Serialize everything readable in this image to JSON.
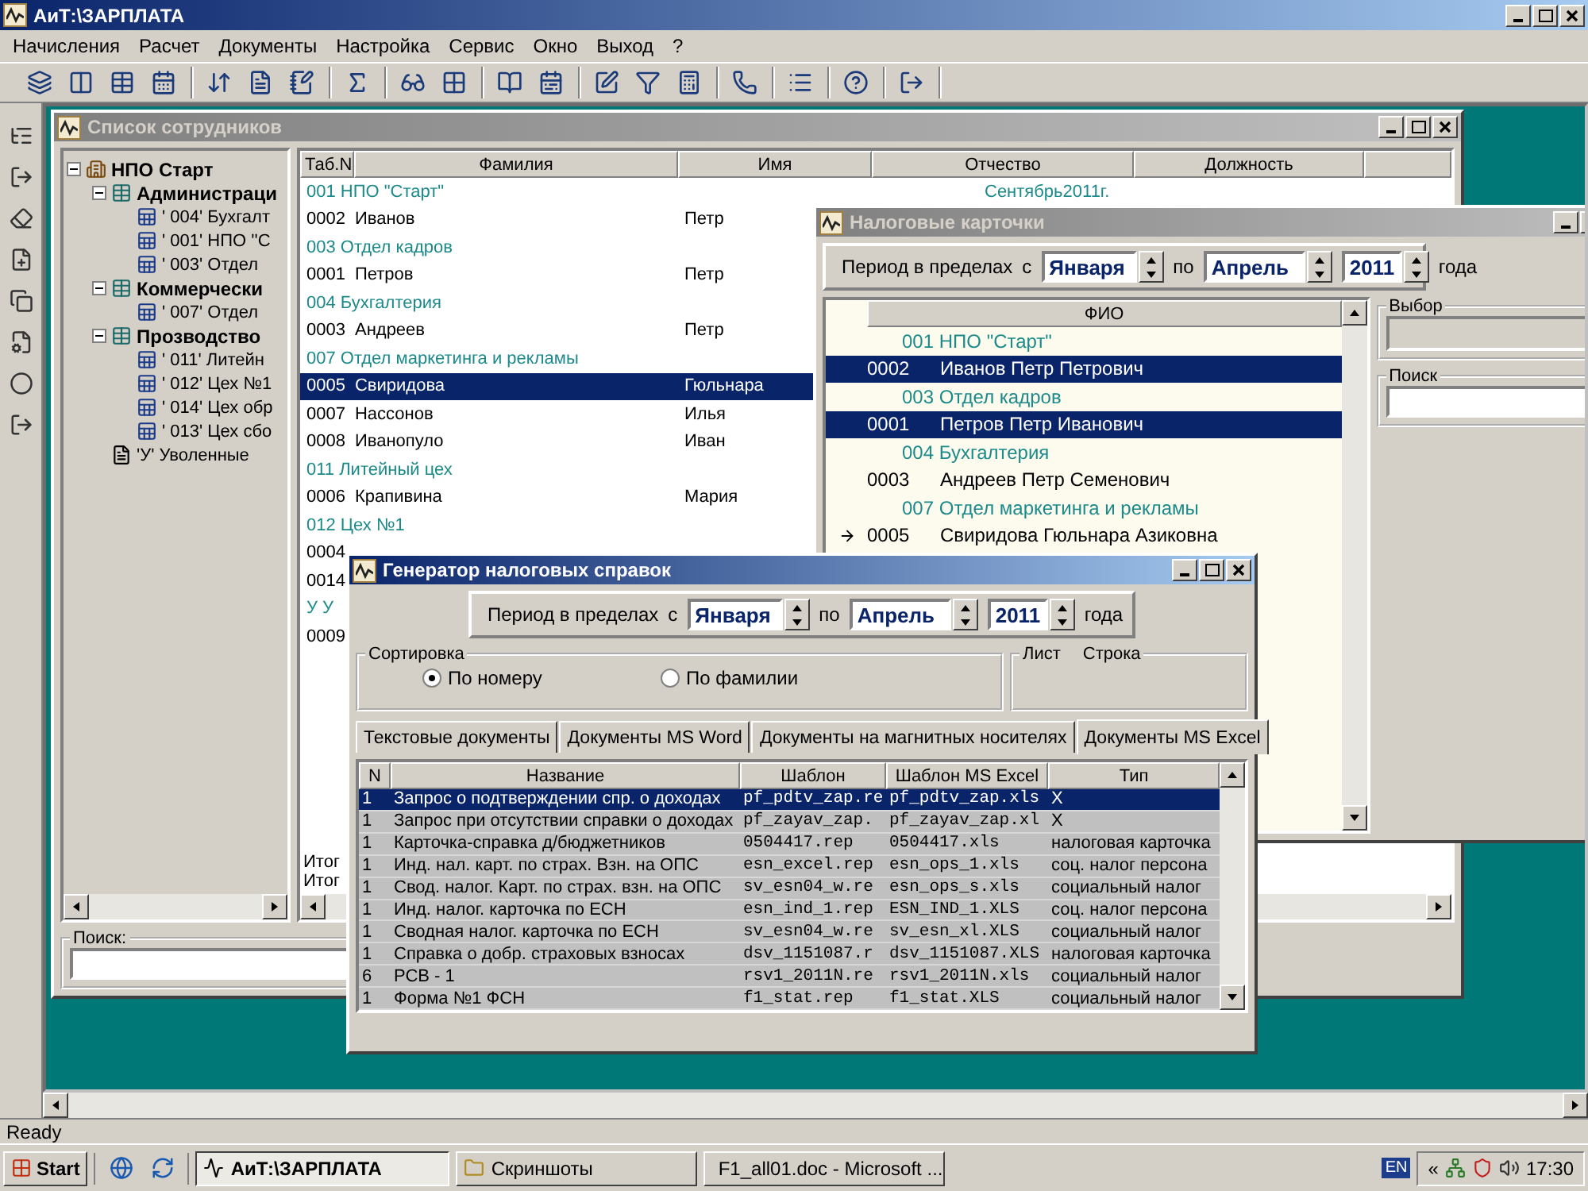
{
  "app": {
    "title": "АиТ:\\ЗАРПЛАТА",
    "active": true
  },
  "menu": [
    "Начисления",
    "Расчет",
    "Документы",
    "Настройка",
    "Сервис",
    "Окно",
    "Выход",
    "?"
  ],
  "employees_window": {
    "title": "Список сотрудников",
    "active": false,
    "tree": [
      {
        "label": "НПО Старт",
        "kind": "company",
        "expanded": true,
        "children": [
          {
            "label": "Администраци",
            "kind": "division",
            "expanded": true,
            "children": [
              {
                "label": "' 004' Бухгалт",
                "kind": "department"
              },
              {
                "label": "' 001' НПО ''С",
                "kind": "department"
              },
              {
                "label": "' 003' Отдел",
                "kind": "department"
              }
            ]
          },
          {
            "label": "Коммерчески",
            "kind": "division",
            "expanded": true,
            "children": [
              {
                "label": "' 007' Отдел",
                "kind": "department"
              }
            ]
          },
          {
            "label": "Прозводство",
            "kind": "division",
            "expanded": true,
            "children": [
              {
                "label": "' 011' Литейн",
                "kind": "department"
              },
              {
                "label": "' 012' Цех №1",
                "kind": "department"
              },
              {
                "label": "' 014' Цех обр",
                "kind": "department"
              },
              {
                "label": "' 013' Цех сбо",
                "kind": "department"
              }
            ]
          },
          {
            "label": "'У' Уволенные",
            "kind": "dismissed"
          }
        ]
      }
    ],
    "columns": [
      "Таб.N",
      "Фамилия",
      "Имя",
      "Отчество",
      "Должность"
    ],
    "rows": [
      {
        "kind": "group",
        "text": "001 НПО \"Старт\"",
        "note": "Сентябрь2011г.",
        "selected": false
      },
      {
        "kind": "person",
        "num": "0002",
        "surname": "Иванов",
        "name": "Петр",
        "selected": false
      },
      {
        "kind": "group",
        "text": "003 Отдел кадров",
        "selected": false
      },
      {
        "kind": "person",
        "num": "0001",
        "surname": "Петров",
        "name": "Петр",
        "selected": false
      },
      {
        "kind": "group",
        "text": "004 Бухгалтерия",
        "selected": false
      },
      {
        "kind": "person",
        "num": "0003",
        "surname": "Андреев",
        "name": "Петр",
        "selected": false
      },
      {
        "kind": "group",
        "text": "007 Отдел маркетинга и рекламы",
        "selected": false
      },
      {
        "kind": "person",
        "num": "0005",
        "surname": "Свиридова",
        "name": "Гюльнара",
        "selected": true
      },
      {
        "kind": "person",
        "num": "0007",
        "surname": "Нассонов",
        "name": "Илья",
        "selected": false
      },
      {
        "kind": "person",
        "num": "0008",
        "surname": "Иванопуло",
        "name": "Иван",
        "selected": false
      },
      {
        "kind": "group",
        "text": "011 Литейный цех",
        "selected": false
      },
      {
        "kind": "person",
        "num": "0006",
        "surname": "Крапивина",
        "name": "Мария",
        "selected": false
      },
      {
        "kind": "group",
        "text": "012 Цех №1",
        "selected": false
      },
      {
        "kind": "person",
        "num": "0004",
        "selected": false
      },
      {
        "kind": "person",
        "num": "0014",
        "selected": false
      },
      {
        "kind": "group",
        "text": "У У",
        "selected": false
      },
      {
        "kind": "person",
        "num": "0009",
        "selected": false
      }
    ],
    "totals": [
      "Итог",
      "Итог"
    ],
    "search_label": "Поиск:"
  },
  "tax_window": {
    "title": "Налоговые карточки",
    "active": false,
    "period": {
      "label": "Период в пределах",
      "from_prefix": "с",
      "from": "Января",
      "to_prefix": "по",
      "to": "Апрель",
      "year": "2011",
      "suffix": "года"
    },
    "column": "ФИО",
    "rows": [
      {
        "kind": "group",
        "text": "001 НПО \"Старт\"",
        "selected": false,
        "current": false
      },
      {
        "kind": "person",
        "num": "0002",
        "name": "Иванов Петр Петрович",
        "selected": true,
        "current": false
      },
      {
        "kind": "group",
        "text": "003 Отдел кадров",
        "selected": false,
        "current": false
      },
      {
        "kind": "person",
        "num": "0001",
        "name": "Петров Петр Иванович",
        "selected": true,
        "current": false
      },
      {
        "kind": "group",
        "text": "004 Бухгалтерия",
        "selected": false,
        "current": false
      },
      {
        "kind": "person",
        "num": "0003",
        "name": "Андреев Петр Семенович",
        "selected": false,
        "current": false
      },
      {
        "kind": "group",
        "text": "007 Отдел маркетинга и рекламы",
        "selected": false,
        "current": false
      },
      {
        "kind": "person",
        "num": "0005",
        "name": "Свиридова Гюльнара Азиковна",
        "selected": false,
        "current": true
      }
    ],
    "choice_label": "Выбор",
    "search_label": "Поиск"
  },
  "generator_window": {
    "title": "Генератор налоговых справок",
    "active": true,
    "period": {
      "label": "Период в пределах",
      "from_prefix": "с",
      "from": "Января",
      "to_prefix": "по",
      "to": "Апрель",
      "year": "2011",
      "suffix": "года"
    },
    "sort": {
      "label": "Сортировка",
      "options": [
        {
          "label": "По номеру",
          "selected": true
        },
        {
          "label": "По фамилии",
          "selected": false
        }
      ]
    },
    "sheet_labels": [
      "Лист",
      "Строка"
    ],
    "tabs": [
      {
        "label": "Текстовые документы",
        "selected": false
      },
      {
        "label": "Документы MS Word",
        "selected": false
      },
      {
        "label": "Документы на магнитных носителях",
        "selected": false
      },
      {
        "label": "Документы MS Excel",
        "selected": true
      }
    ],
    "columns": [
      "N",
      "Название",
      "Шаблон",
      "Шаблон MS Excel",
      "Тип"
    ],
    "rows": [
      {
        "n": "1",
        "name": "Запрос о подтверждении спр. о доходах",
        "template": "pf_pdtv_zap.re",
        "excel": "pf_pdtv_zap.xls",
        "type": "X",
        "selected": true
      },
      {
        "n": "1",
        "name": "Запрос при отсутствии справки о доходах",
        "template": "pf_zayav_zap.",
        "excel": "pf_zayav_zap.xl",
        "type": "X",
        "selected": false
      },
      {
        "n": "1",
        "name": "Карточка-справка д/бюджетников",
        "template": "0504417.rep",
        "excel": "0504417.xls",
        "type": "налоговая карточка",
        "selected": false
      },
      {
        "n": "1",
        "name": "Инд. нал. карт. по страх. Взн. на ОПС",
        "template": "esn_excel.rep",
        "excel": "esn_ops_1.xls",
        "type": "соц. налог персона",
        "selected": false
      },
      {
        "n": "1",
        "name": "Свод. налог. Карт. по страх. взн. на ОПС",
        "template": "sv_esn04_w.re",
        "excel": "esn_ops_s.xls",
        "type": "социальный налог",
        "selected": false
      },
      {
        "n": "1",
        "name": "Инд. налог. карточка по ЕСН",
        "template": "esn_ind_1.rep",
        "excel": "ESN_IND_1.XLS",
        "type": "соц. налог персона",
        "selected": false
      },
      {
        "n": "1",
        "name": "Сводная налог. карточка по ЕСН",
        "template": "sv_esn04_w.re",
        "excel": "sv_esn_xl.XLS",
        "type": "социальный налог",
        "selected": false
      },
      {
        "n": "1",
        "name": "Справка о добр. страховых взносах",
        "template": "dsv_1151087.r",
        "excel": "dsv_1151087.XLS",
        "type": "налоговая карточка",
        "selected": false
      },
      {
        "n": "6",
        "name": "РСВ - 1",
        "template": "rsv1_2011N.re",
        "excel": "rsv1_2011N.xls",
        "type": "социальный налог",
        "selected": false
      },
      {
        "n": "1",
        "name": "Форма №1 ФСН",
        "template": "f1_stat.rep",
        "excel": "f1_stat.XLS",
        "type": "социальный налог",
        "selected": false
      }
    ]
  },
  "status": "Ready",
  "taskbar": {
    "start": "Start",
    "tasks": [
      {
        "label": "АиТ:\\ЗАРПЛАТА",
        "kind": "app",
        "active": true
      },
      {
        "label": "Скриншоты",
        "kind": "folder",
        "active": false
      },
      {
        "label": "F1_all01.doc - Microsoft ...",
        "kind": "document",
        "active": false
      }
    ],
    "language": "EN",
    "chevron": "«",
    "clock": "17:30"
  }
}
